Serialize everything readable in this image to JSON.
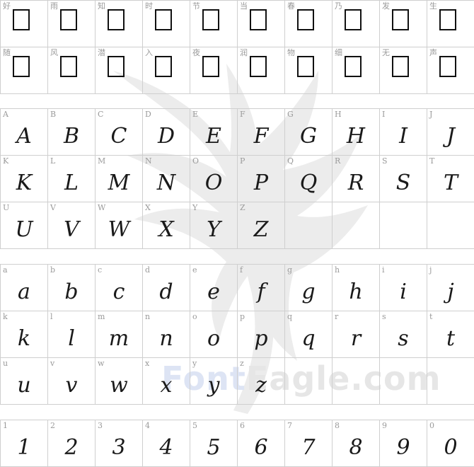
{
  "watermark": {
    "brand_part1": "Font",
    "brand_part2": "Eagle.com"
  },
  "sections": [
    {
      "id": "chinese",
      "cells": [
        {
          "key": "好",
          "glyph": "",
          "tofu": true
        },
        {
          "key": "雨",
          "glyph": "",
          "tofu": true
        },
        {
          "key": "知",
          "glyph": "",
          "tofu": true
        },
        {
          "key": "时",
          "glyph": "",
          "tofu": true
        },
        {
          "key": "节",
          "glyph": "",
          "tofu": true
        },
        {
          "key": "当",
          "glyph": "",
          "tofu": true
        },
        {
          "key": "春",
          "glyph": "",
          "tofu": true
        },
        {
          "key": "乃",
          "glyph": "",
          "tofu": true
        },
        {
          "key": "发",
          "glyph": "",
          "tofu": true
        },
        {
          "key": "生",
          "glyph": "",
          "tofu": true
        },
        {
          "key": "随",
          "glyph": "",
          "tofu": true
        },
        {
          "key": "风",
          "glyph": "",
          "tofu": true
        },
        {
          "key": "潜",
          "glyph": "",
          "tofu": true
        },
        {
          "key": "入",
          "glyph": "",
          "tofu": true
        },
        {
          "key": "夜",
          "glyph": "",
          "tofu": true
        },
        {
          "key": "润",
          "glyph": "",
          "tofu": true
        },
        {
          "key": "物",
          "glyph": "",
          "tofu": true
        },
        {
          "key": "细",
          "glyph": "",
          "tofu": true
        },
        {
          "key": "无",
          "glyph": "",
          "tofu": true
        },
        {
          "key": "声",
          "glyph": "",
          "tofu": true
        }
      ]
    },
    {
      "id": "uppercase",
      "cells": [
        {
          "key": "A",
          "glyph": "A"
        },
        {
          "key": "B",
          "glyph": "B"
        },
        {
          "key": "C",
          "glyph": "C"
        },
        {
          "key": "D",
          "glyph": "D"
        },
        {
          "key": "E",
          "glyph": "E"
        },
        {
          "key": "F",
          "glyph": "F"
        },
        {
          "key": "G",
          "glyph": "G"
        },
        {
          "key": "H",
          "glyph": "H"
        },
        {
          "key": "I",
          "glyph": "I"
        },
        {
          "key": "J",
          "glyph": "J"
        },
        {
          "key": "K",
          "glyph": "K"
        },
        {
          "key": "L",
          "glyph": "L"
        },
        {
          "key": "M",
          "glyph": "M"
        },
        {
          "key": "N",
          "glyph": "N"
        },
        {
          "key": "O",
          "glyph": "O"
        },
        {
          "key": "P",
          "glyph": "P"
        },
        {
          "key": "Q",
          "glyph": "Q"
        },
        {
          "key": "R",
          "glyph": "R"
        },
        {
          "key": "S",
          "glyph": "S"
        },
        {
          "key": "T",
          "glyph": "T"
        },
        {
          "key": "U",
          "glyph": "U"
        },
        {
          "key": "V",
          "glyph": "V"
        },
        {
          "key": "W",
          "glyph": "W"
        },
        {
          "key": "X",
          "glyph": "X"
        },
        {
          "key": "Y",
          "glyph": "Y"
        },
        {
          "key": "Z",
          "glyph": "Z"
        },
        {
          "key": "",
          "glyph": ""
        },
        {
          "key": "",
          "glyph": ""
        },
        {
          "key": "",
          "glyph": ""
        },
        {
          "key": "",
          "glyph": ""
        }
      ]
    },
    {
      "id": "lowercase",
      "cells": [
        {
          "key": "a",
          "glyph": "a"
        },
        {
          "key": "b",
          "glyph": "b"
        },
        {
          "key": "c",
          "glyph": "c"
        },
        {
          "key": "d",
          "glyph": "d"
        },
        {
          "key": "e",
          "glyph": "e"
        },
        {
          "key": "f",
          "glyph": "f"
        },
        {
          "key": "g",
          "glyph": "g"
        },
        {
          "key": "h",
          "glyph": "h"
        },
        {
          "key": "i",
          "glyph": "i"
        },
        {
          "key": "j",
          "glyph": "j"
        },
        {
          "key": "k",
          "glyph": "k"
        },
        {
          "key": "l",
          "glyph": "l"
        },
        {
          "key": "m",
          "glyph": "m"
        },
        {
          "key": "n",
          "glyph": "n"
        },
        {
          "key": "o",
          "glyph": "o"
        },
        {
          "key": "p",
          "glyph": "p"
        },
        {
          "key": "q",
          "glyph": "q"
        },
        {
          "key": "r",
          "glyph": "r"
        },
        {
          "key": "s",
          "glyph": "s"
        },
        {
          "key": "t",
          "glyph": "t"
        },
        {
          "key": "u",
          "glyph": "u"
        },
        {
          "key": "v",
          "glyph": "v"
        },
        {
          "key": "w",
          "glyph": "w"
        },
        {
          "key": "x",
          "glyph": "x"
        },
        {
          "key": "y",
          "glyph": "y"
        },
        {
          "key": "z",
          "glyph": "z"
        },
        {
          "key": "",
          "glyph": ""
        },
        {
          "key": "",
          "glyph": ""
        },
        {
          "key": "",
          "glyph": ""
        },
        {
          "key": "",
          "glyph": ""
        }
      ]
    },
    {
      "id": "digits",
      "cells": [
        {
          "key": "1",
          "glyph": "1"
        },
        {
          "key": "2",
          "glyph": "2"
        },
        {
          "key": "3",
          "glyph": "3"
        },
        {
          "key": "4",
          "glyph": "4"
        },
        {
          "key": "5",
          "glyph": "5"
        },
        {
          "key": "6",
          "glyph": "6"
        },
        {
          "key": "7",
          "glyph": "7"
        },
        {
          "key": "8",
          "glyph": "8"
        },
        {
          "key": "9",
          "glyph": "9"
        },
        {
          "key": "0",
          "glyph": "0"
        }
      ]
    }
  ]
}
